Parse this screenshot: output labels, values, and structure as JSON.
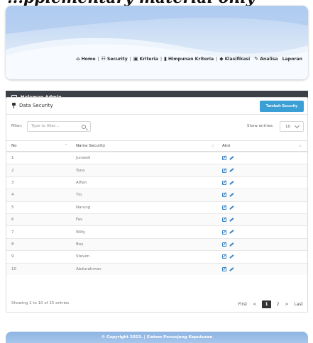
{
  "header": {
    "top_text": "...pplementary material only",
    "nav": [
      {
        "label": "Home",
        "icon": "home-icon"
      },
      {
        "label": "Security",
        "icon": "users-icon"
      },
      {
        "label": "Kriteria",
        "icon": "chart-icon"
      },
      {
        "label": "Himpunan Kriteria",
        "icon": "bookmark-icon"
      },
      {
        "label": "Klasifikasi",
        "icon": "tag-icon"
      },
      {
        "label": "Analisa",
        "icon": "pencil-icon"
      },
      {
        "label": "Laporan",
        "icon": ""
      }
    ]
  },
  "admin_bar": {
    "title": "Halaman Admin"
  },
  "panel": {
    "title": "Data Security",
    "add_button": "Tambah Security",
    "filter_label": "Filter:",
    "filter_placeholder": "Type to filter...",
    "show_label": "Show entries:",
    "show_value": "10"
  },
  "table": {
    "columns": [
      "No",
      "Nama Security",
      "Aksi"
    ],
    "rows": [
      {
        "no": "1",
        "name": "Junaedi"
      },
      {
        "no": "2",
        "name": "Tono"
      },
      {
        "no": "3",
        "name": "Alfian"
      },
      {
        "no": "4",
        "name": "Tio"
      },
      {
        "no": "5",
        "name": "Narung"
      },
      {
        "no": "6",
        "name": "Fav"
      },
      {
        "no": "7",
        "name": "Willy"
      },
      {
        "no": "8",
        "name": "Boy"
      },
      {
        "no": "9",
        "name": "Steven"
      },
      {
        "no": "10",
        "name": "Abdurahman"
      }
    ]
  },
  "pagination": {
    "info": "Showing 1 to 10 of 15 entries",
    "first": "First",
    "prev": "<",
    "current": "1",
    "next_page": "2",
    "next": ">",
    "last": "Last"
  },
  "footer": {
    "copyright": "© Copyright 2023. | Sistem Penunjang Keputusan"
  },
  "colors": {
    "accent": "#3a9fd5",
    "admin_bar": "#3c4148",
    "icon_blue": "#3b84c4"
  }
}
